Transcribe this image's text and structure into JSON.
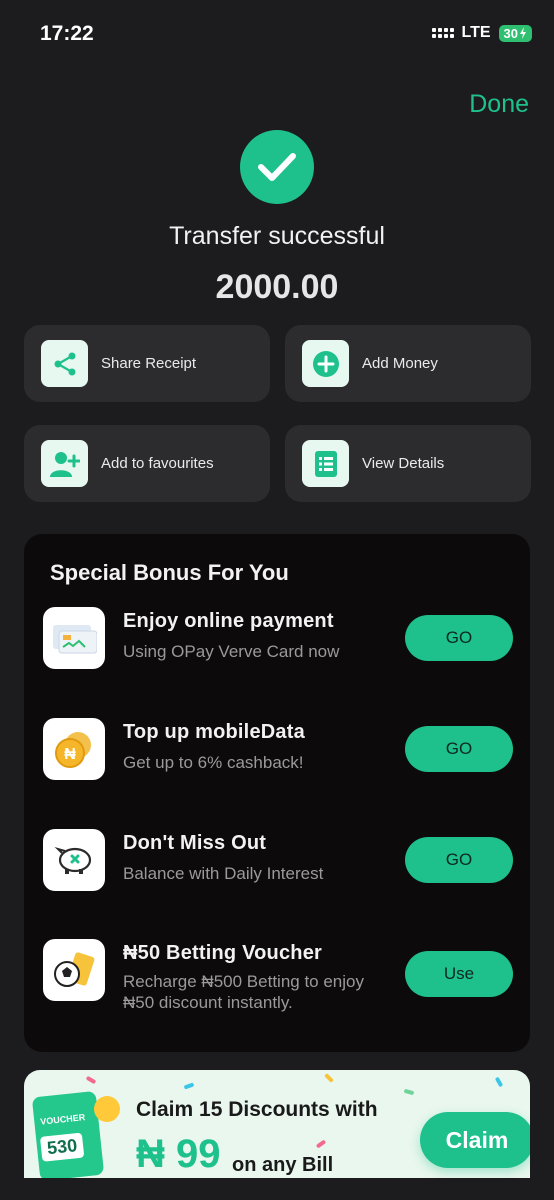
{
  "status_bar": {
    "time": "17:22",
    "network": "LTE",
    "battery": "30"
  },
  "header": {
    "done_label": "Done"
  },
  "result": {
    "title": "Transfer successful",
    "amount": "2000.00"
  },
  "actions": [
    {
      "label": "Share Receipt",
      "icon": "share-icon"
    },
    {
      "label": "Add Money",
      "icon": "plus-circle-icon"
    },
    {
      "label": "Add to favourites",
      "icon": "add-user-icon"
    },
    {
      "label": "View Details",
      "icon": "list-icon"
    }
  ],
  "bonus": {
    "title": "Special Bonus For You",
    "items": [
      {
        "title": "Enjoy online payment",
        "subtitle": "Using OPay Verve Card now",
        "button": "GO",
        "icon": "card-icon"
      },
      {
        "title": "Top up mobileData",
        "subtitle": "Get up to 6% cashback!",
        "button": "GO",
        "icon": "coin-icon"
      },
      {
        "title": "Don't Miss Out",
        "subtitle": "Balance with Daily Interest",
        "button": "GO",
        "icon": "piggy-bank-icon"
      },
      {
        "title": "₦50 Betting Voucher",
        "subtitle": "Recharge ₦500 Betting to enjoy ₦50 discount instantly.",
        "button": "Use",
        "icon": "football-voucher-icon"
      }
    ]
  },
  "promo": {
    "voucher_label": "VOUCHER",
    "voucher_number": "530",
    "line1": "Claim 15 Discounts with",
    "price": "₦ 99",
    "suffix": "on any Bill",
    "button": "Claim"
  },
  "colors": {
    "accent": "#1ec08c",
    "background": "#1c1c1e",
    "card": "#2c2c2e",
    "panel": "#0d0a0c"
  }
}
